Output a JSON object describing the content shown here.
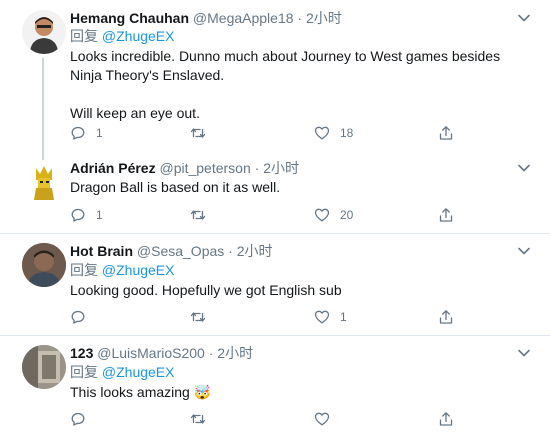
{
  "tweets": [
    {
      "name": "Hemang Chauhan",
      "handle": "@MegaApple18",
      "time": "· 2小时",
      "reply_prefix": "回复",
      "reply_to": "@ZhugeEX",
      "text_1": "Looks incredible. Dunno much about Journey to West games besides Ninja Theory's Enslaved.",
      "text_2": "Will keep an eye out.",
      "reply_count": "1",
      "retweet_count": "",
      "like_count": "18"
    },
    {
      "name": "Adrián Pérez",
      "handle": "@pit_peterson",
      "time": "· 2小时",
      "text": "Dragon Ball is based on it as well.",
      "reply_count": "1",
      "retweet_count": "",
      "like_count": "20"
    },
    {
      "name": "Hot Brain",
      "handle": "@Sesa_Opas",
      "time": "· 2小时",
      "reply_prefix": "回复",
      "reply_to": "@ZhugeEX",
      "text": "Looking good. Hopefully we got English sub",
      "reply_count": "",
      "retweet_count": "",
      "like_count": "1"
    },
    {
      "name": "123",
      "handle": "@LuisMarioS200",
      "time": "· 2小时",
      "reply_prefix": "回复",
      "reply_to": "@ZhugeEX",
      "text": "This looks amazing 🤯",
      "reply_count": "",
      "retweet_count": "",
      "like_count": ""
    }
  ],
  "icons": {
    "reply": "reply-icon",
    "retweet": "retweet-icon",
    "like": "heart-icon",
    "share": "share-icon",
    "more": "chevron-down-icon"
  },
  "colors": {
    "text": "#14171a",
    "secondary": "#657786",
    "link": "#1b95e0",
    "divider": "#e1e8ed",
    "thread_line": "#ccd6dd"
  }
}
